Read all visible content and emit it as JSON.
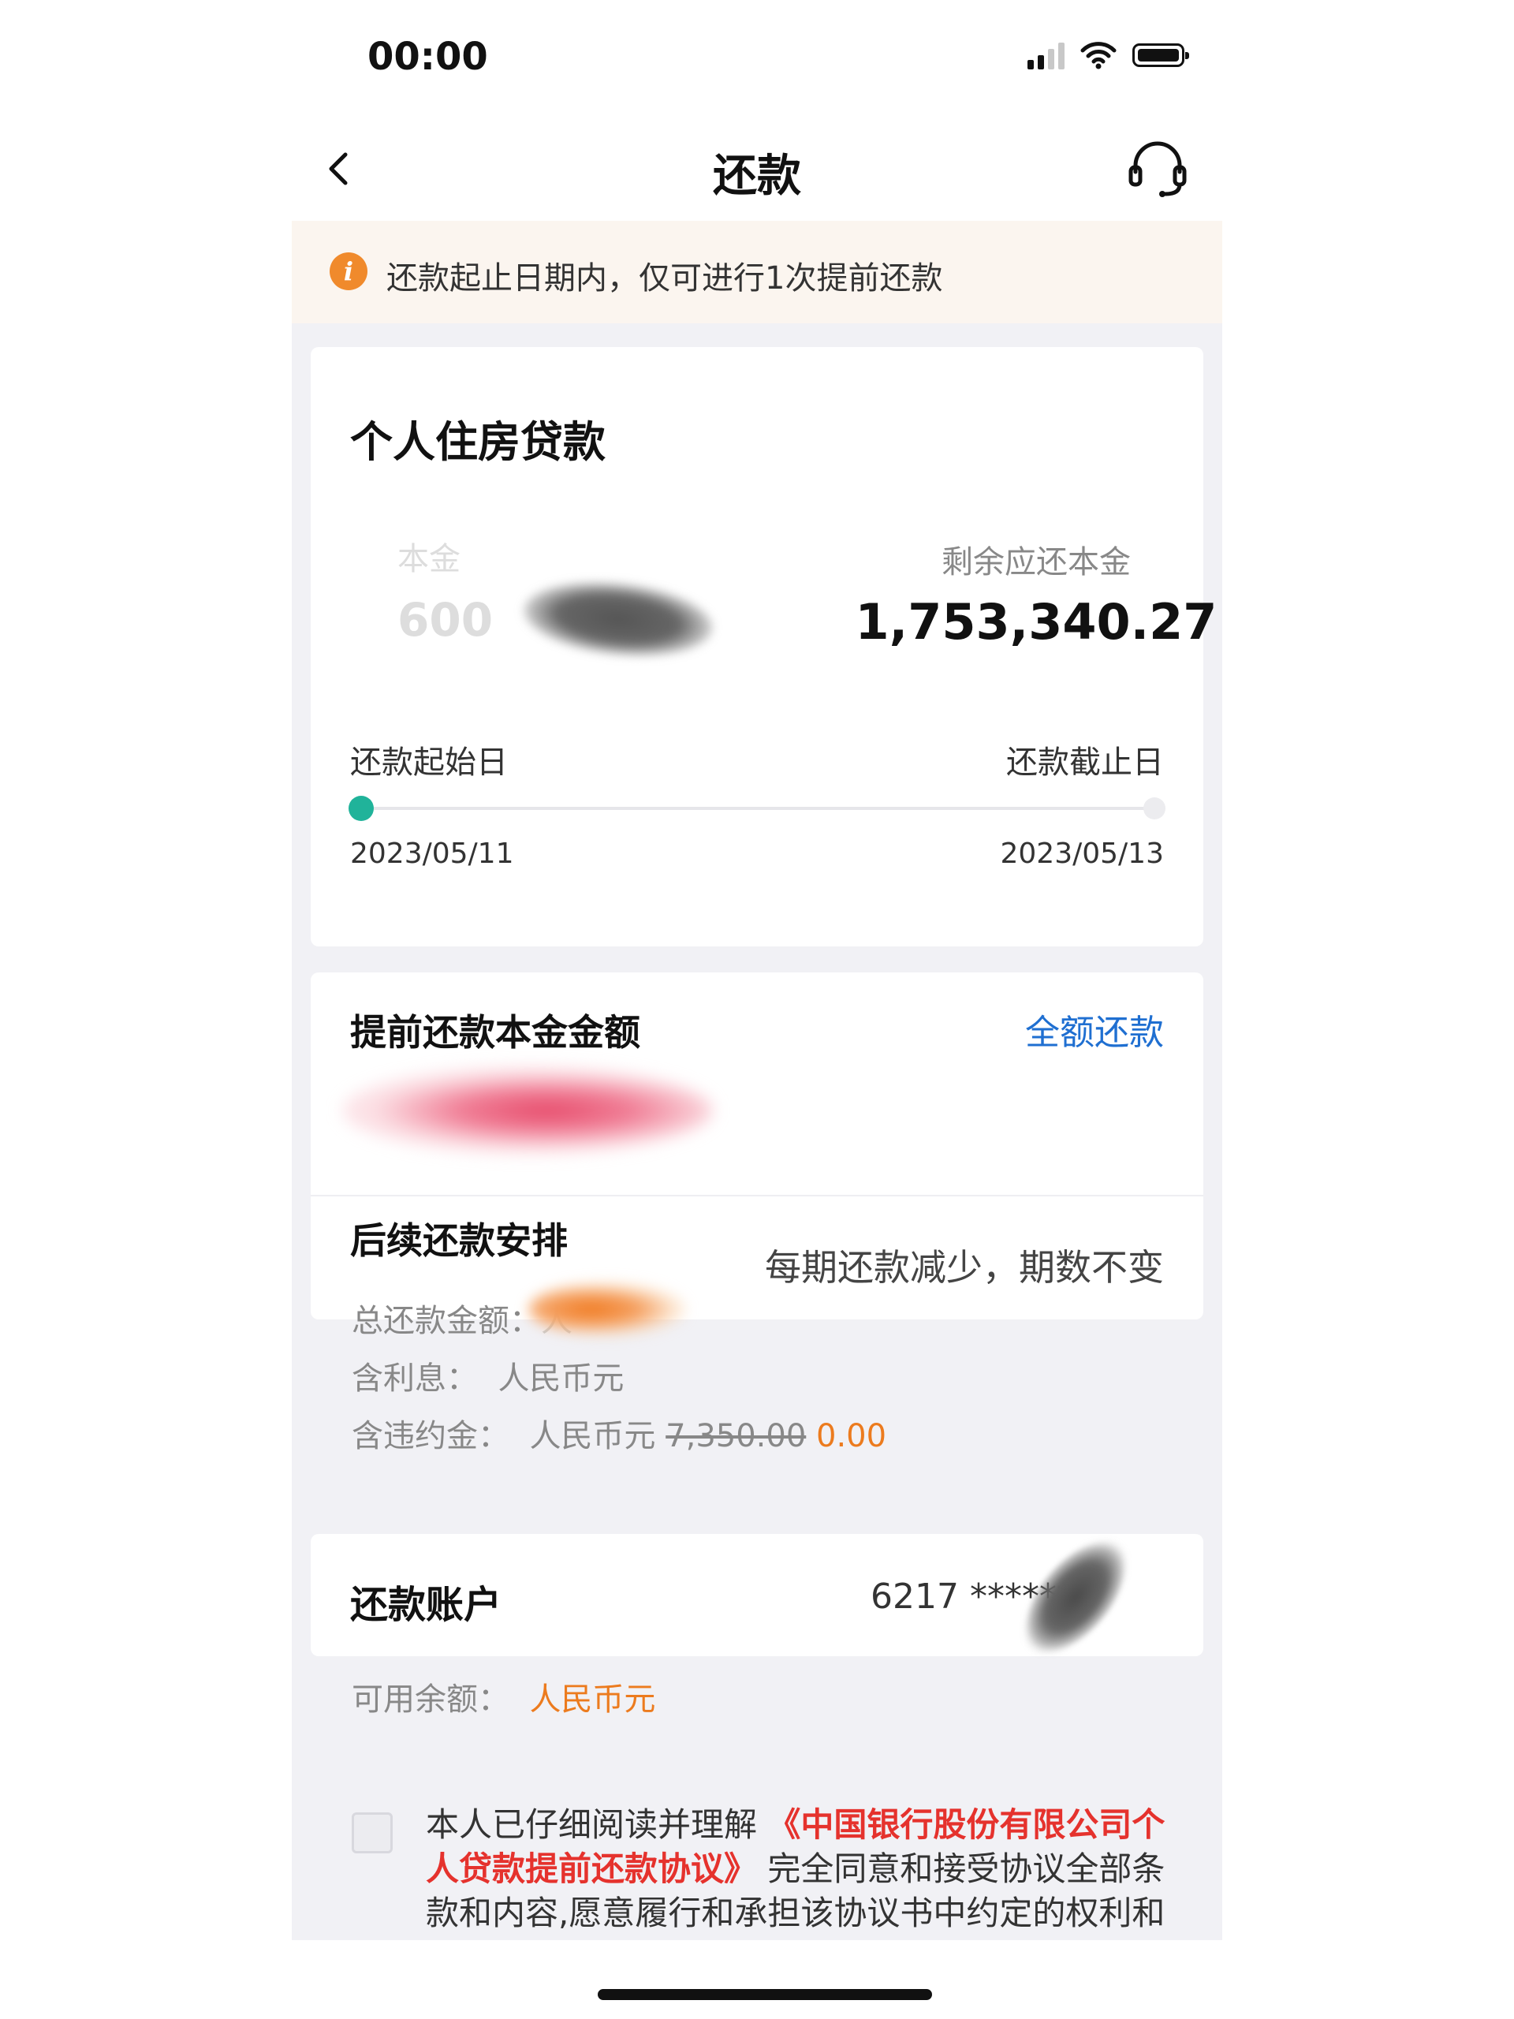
{
  "status_bar": {
    "time": "00:00"
  },
  "nav": {
    "title": "还款"
  },
  "notice": {
    "text": "还款起止日期内，仅可进行1次提前还款"
  },
  "loan": {
    "title": "个人住房贷款",
    "principal_label": "本金",
    "principal_value": "600",
    "remaining_label": "剩余应还本金",
    "remaining_value": "1,753,340.27",
    "start_label": "还款起始日",
    "end_label": "还款截止日",
    "start_date": "2023/05/11",
    "end_date": "2023/05/13"
  },
  "prepay": {
    "label": "提前还款本金金额",
    "full_repay": "全额还款",
    "follow_label": "后续还款安排",
    "follow_value": "每期还款减少，期数不变"
  },
  "summary": {
    "total_label": "总还款金额：",
    "total_prefix": "人",
    "interest_label": "含利息：",
    "interest_value": "人民币元",
    "penalty_label": "含违约金：",
    "penalty_currency": "人民币元",
    "penalty_original": "7,350.00",
    "penalty_actual": "0.00"
  },
  "account": {
    "label": "还款账户",
    "number": "6217 ******",
    "balance_label": "可用余额：",
    "balance_value": "人民币元"
  },
  "agreement": {
    "prefix": "本人已仔细阅读并理解",
    "link": "《中国银行股份有限公司个人贷款提前还款协议》",
    "suffix": "完全同意和接受协议全部条款和内容,愿意履行和承担该协议书中约定的权利和义务"
  },
  "colors": {
    "accent_blue": "#1f6fd1",
    "accent_orange": "#ec7b1e",
    "accent_red": "#e5322d",
    "progress_green": "#20b39a",
    "notice_bg": "#fbf5ef"
  }
}
